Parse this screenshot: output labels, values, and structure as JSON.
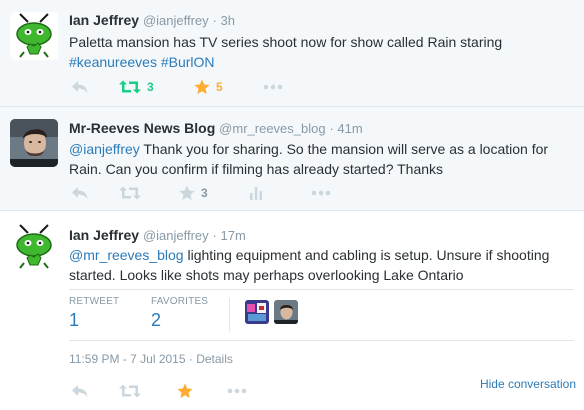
{
  "tweets": [
    {
      "name": "Ian Jeffrey",
      "handle": "@ianjeffrey",
      "time": "· 3h",
      "text": "Paletta mansion has TV series shoot now for show called Rain staring",
      "hashtag1": "#keanureeves",
      "hashtag2": "#BurlON",
      "retweet_count": "3",
      "favorite_count": "5",
      "avatar_icon": "green-alien-icon"
    },
    {
      "name": "Mr-Reeves News Blog",
      "handle": "@mr_reeves_blog",
      "time": "· 41m",
      "mention": "@ianjeffrey",
      "text": "Thank you for sharing. So the mansion will serve as a location for Rain. Can you confirm if filming has already started? Thanks",
      "favorite_count": "3",
      "avatar_icon": "man-photo-avatar"
    },
    {
      "name": "Ian Jeffrey",
      "handle": "@ianjeffrey",
      "time": "· 17m",
      "mention": "@mr_reeves_blog",
      "text": "lighting equipment and cabling is setup. Unsure if shooting started. Looks like shots may perhaps overlooking Lake Ontario",
      "retweet_label": "RETWEET",
      "retweet_count": "1",
      "favorites_label": "FAVORITES",
      "favorites_count": "2",
      "timestamp": "11:59 PM - 7 Jul 2015",
      "details_link": "· Details",
      "hide_conversation": "Hide conversation",
      "avatar_icon": "green-alien-icon"
    }
  ],
  "colors": {
    "link": "#2b7bb9",
    "retweeted_green": "#19cf86",
    "favorited_orange": "#ffac33",
    "muted_gray": "#8899a6",
    "icon_gray": "#ccd6dd",
    "alien_green": "#3fb82f"
  }
}
